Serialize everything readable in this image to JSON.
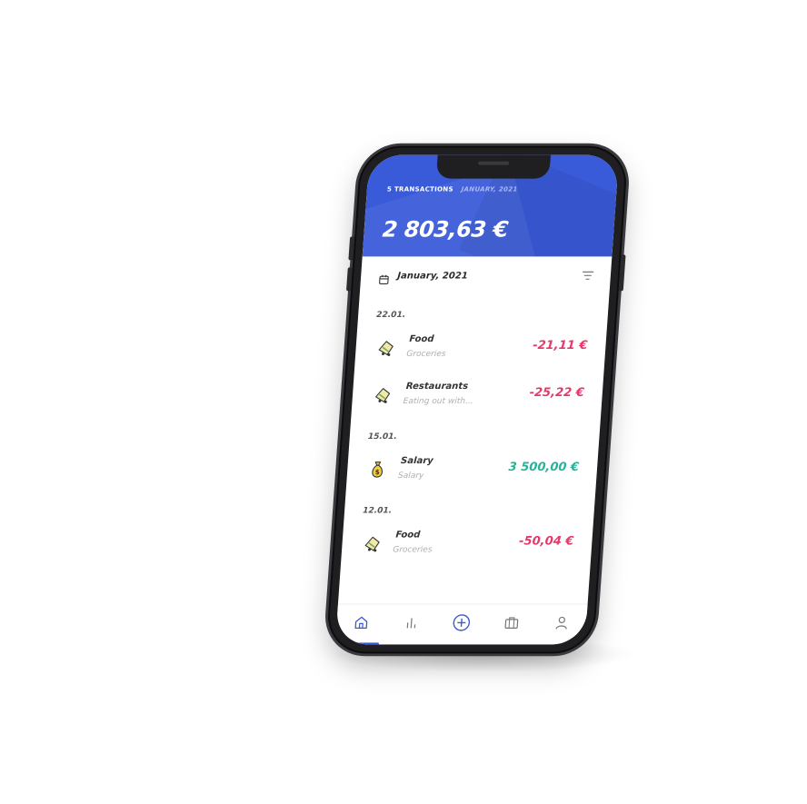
{
  "header": {
    "transactions_label": "5 TRANSACTIONS",
    "period_label": "JANUARY, 2021",
    "balance": "2 803,63 €"
  },
  "month_bar": {
    "label": "January, 2021"
  },
  "groups": [
    {
      "date": "22.01.",
      "transactions": [
        {
          "title": "Food",
          "subtitle": "Groceries",
          "amount": "-21,11 €",
          "icon": "food-cart-icon",
          "type": "expense"
        },
        {
          "title": "Restaurants",
          "subtitle": "Eating out with...",
          "amount": "-25,22 €",
          "icon": "food-cart-icon",
          "type": "expense"
        }
      ]
    },
    {
      "date": "15.01.",
      "transactions": [
        {
          "title": "Salary",
          "subtitle": "Salary",
          "amount": "3 500,00 €",
          "icon": "money-bag-icon",
          "type": "income"
        }
      ]
    },
    {
      "date": "12.01.",
      "transactions": [
        {
          "title": "Food",
          "subtitle": "Groceries",
          "amount": "-50,04 €",
          "icon": "food-cart-icon",
          "type": "expense"
        }
      ]
    }
  ],
  "tabbar": {
    "items": [
      {
        "name": "home",
        "icon": "home-icon",
        "active": true
      },
      {
        "name": "stats",
        "icon": "bar-chart-icon",
        "active": false
      },
      {
        "name": "add",
        "icon": "plus-circle-icon",
        "active": false
      },
      {
        "name": "wallet",
        "icon": "briefcase-icon",
        "active": false
      },
      {
        "name": "profile",
        "icon": "user-icon",
        "active": false
      }
    ]
  },
  "colors": {
    "accent": "#3a5bd9",
    "expense": "#e33a6b",
    "income": "#27b39a"
  }
}
